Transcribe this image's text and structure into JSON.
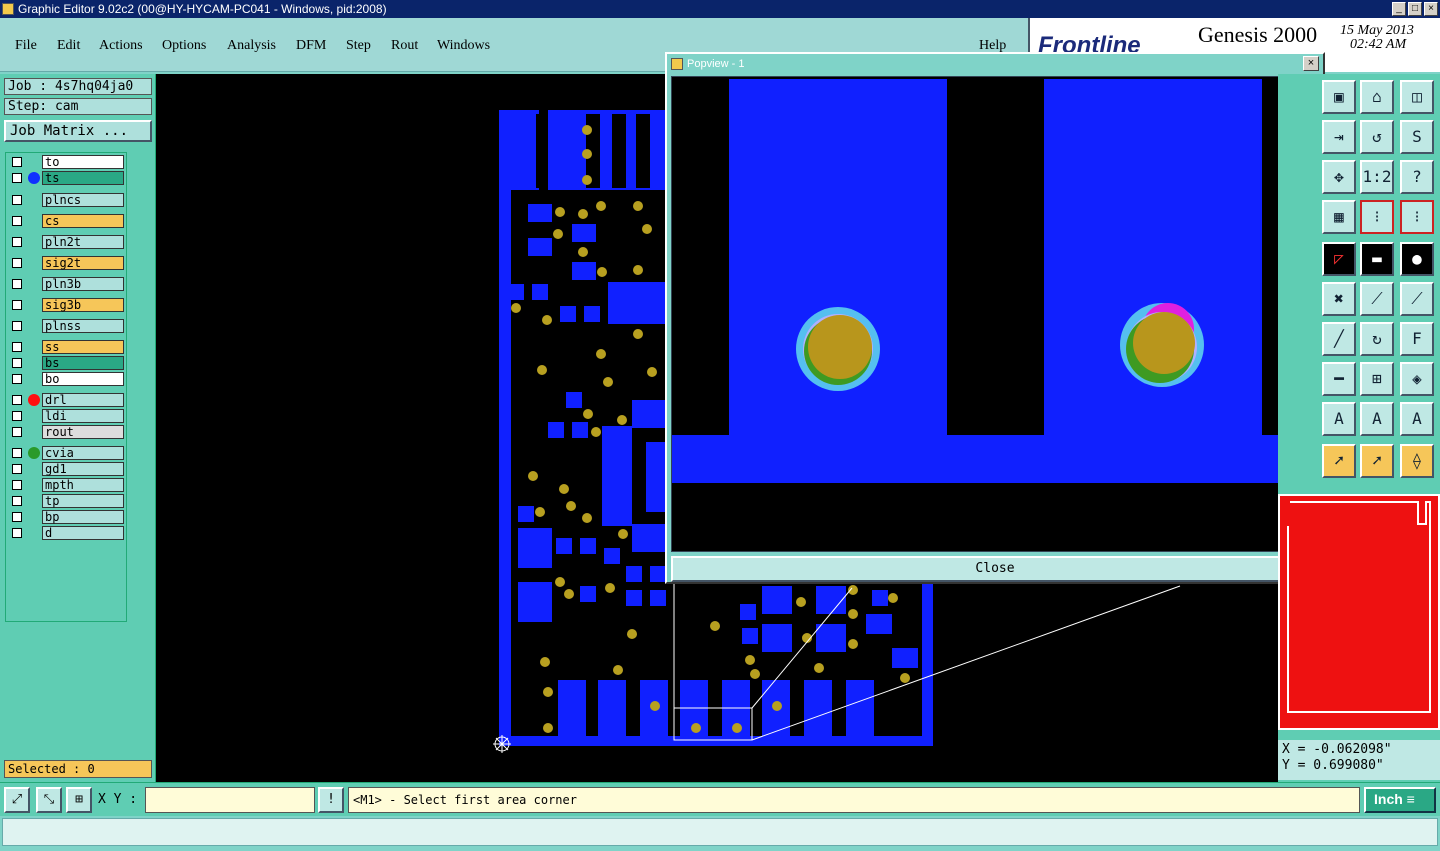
{
  "window": {
    "title": "Graphic Editor 9.02c2 (00@HY-HYCAM-PC041 - Windows, pid:2008)"
  },
  "menu": [
    "File",
    "Edit",
    "Actions",
    "Options",
    "Analysis",
    "DFM",
    "Step",
    "Rout",
    "Windows"
  ],
  "help_label": "Help",
  "brand": {
    "logo": "Frontline",
    "product": "Genesis 2000",
    "date": "15 May 2013",
    "time": "02:42 AM"
  },
  "job": {
    "job_label": "Job : 4s7hq04ja0",
    "step_label": "Step: cam",
    "matrix_button": "Job Matrix ..."
  },
  "layers": [
    {
      "name": "to",
      "color": "#ffffff",
      "dot": ""
    },
    {
      "name": "ts",
      "color": "#2aa885",
      "dot": "#1030ff"
    },
    {
      "name": "plncs",
      "color": "#aee0dc",
      "dot": ""
    },
    {
      "name": "cs",
      "color": "#f6c659",
      "dot": ""
    },
    {
      "name": "pln2t",
      "color": "#aee0dc",
      "dot": ""
    },
    {
      "name": "sig2t",
      "color": "#f6c659",
      "dot": ""
    },
    {
      "name": "pln3b",
      "color": "#aee0dc",
      "dot": ""
    },
    {
      "name": "sig3b",
      "color": "#f6c659",
      "dot": ""
    },
    {
      "name": "plnss",
      "color": "#aee0dc",
      "dot": ""
    },
    {
      "name": "ss",
      "color": "#f6c659",
      "dot": ""
    },
    {
      "name": "bs",
      "color": "#2aa885",
      "dot": ""
    },
    {
      "name": "bo",
      "color": "#ffffff",
      "dot": ""
    },
    {
      "name": "drl",
      "color": "#aee0dc",
      "dot": "#ff1010"
    },
    {
      "name": "ldi",
      "color": "#aee0dc",
      "dot": ""
    },
    {
      "name": "rout",
      "color": "#dddddd",
      "dot": ""
    },
    {
      "name": "cvia",
      "color": "#aee0dc",
      "dot": "#2a9a2a"
    },
    {
      "name": "gd1",
      "color": "#aee0dc",
      "dot": ""
    },
    {
      "name": "mpth",
      "color": "#aee0dc",
      "dot": ""
    },
    {
      "name": "tp",
      "color": "#aee0dc",
      "dot": ""
    },
    {
      "name": "bp",
      "color": "#aee0dc",
      "dot": ""
    },
    {
      "name": "d",
      "color": "#aee0dc",
      "dot": ""
    }
  ],
  "selected_label": "Selected : 0",
  "popup": {
    "title": "Popview - 1",
    "close_label": "Close"
  },
  "coords": {
    "x": "X = -0.062098\"",
    "y": "Y =  0.699080\""
  },
  "status": {
    "xy_label": "X Y :",
    "xy_value": "",
    "prompt": "<M1> - Select first area corner",
    "unit": "Inch"
  },
  "colors": {
    "board": "#1020ff",
    "pad": "#b8a020",
    "bg": "#000000",
    "panel": "#5fcdb3"
  }
}
